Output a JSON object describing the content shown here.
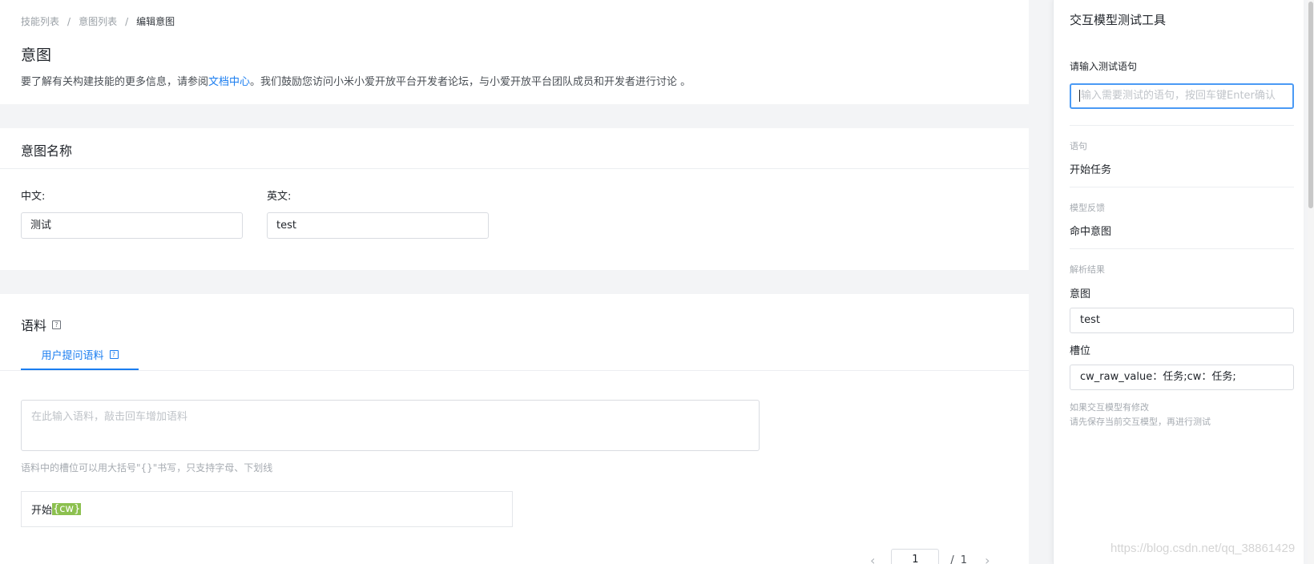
{
  "breadcrumb": {
    "items": [
      "技能列表",
      "意图列表"
    ],
    "current": "编辑意图",
    "separator": "/"
  },
  "page": {
    "title": "意图",
    "desc_before": "要了解有关构建技能的更多信息，请参阅",
    "desc_link": "文档中心",
    "desc_after": "。我们鼓励您访问小米小爱开放平台开发者论坛，与小爱开放平台团队成员和开发者进行讨论 。"
  },
  "intent_name": {
    "title": "意图名称",
    "chinese_label": "中文:",
    "chinese_value": "测试",
    "english_label": "英文:",
    "english_value": "test"
  },
  "corpus": {
    "title": "语料",
    "tab_label": "用户提问语料",
    "input_placeholder": "在此输入语料，敲击回车增加语料",
    "hint": "语料中的槽位可以用大括号\"{}\"书写，只支持字母、下划线",
    "item_text": "开始",
    "item_slot": "{cw}",
    "pager": {
      "prev": "‹",
      "current": "1",
      "separator": "/",
      "total": "1",
      "next": "›"
    }
  },
  "test_panel": {
    "title": "交互模型测试工具",
    "input_label": "请输入测试语句",
    "input_placeholder": "输入需要测试的语句，按回车键Enter确认",
    "sentence_label": "语句",
    "sentence_value": "开始任务",
    "feedback_label": "模型反馈",
    "feedback_value": "命中意图",
    "result_label": "解析结果",
    "intent_label": "意图",
    "intent_value": "test",
    "slot_label": "槽位",
    "slot_value": "cw_raw_value：任务;cw：任务;",
    "note_line1": "如果交互模型有修改",
    "note_line2": "请先保存当前交互模型，再进行测试"
  },
  "watermark": "https://blog.csdn.net/qq_38861429",
  "colors": {
    "accent": "#1a7df0",
    "slot_highlight": "#8cc04f",
    "background": "#f3f4f6"
  },
  "icons": [
    "help-icon",
    "chevron-left-icon",
    "chevron-right-icon"
  ]
}
